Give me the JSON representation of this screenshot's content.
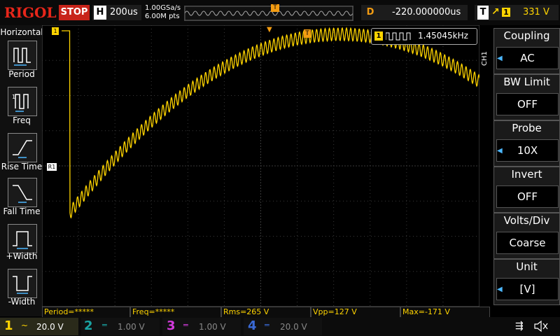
{
  "brand": "RIGOL",
  "run_state": "STOP",
  "horizontal": {
    "label": "H",
    "timebase": "200us",
    "sample_rate": "1.00GSa/s",
    "memory_depth": "6.00M pts"
  },
  "delay": {
    "label": "D",
    "value": "-220.000000us"
  },
  "trigger": {
    "label": "T",
    "edge_icon": "rising-edge-icon",
    "channel": "1",
    "level": "331 V"
  },
  "left_menu": {
    "title": "Horizontal",
    "items": [
      {
        "label": "Period",
        "icon": "period-icon"
      },
      {
        "label": "Freq",
        "icon": "frequency-icon"
      },
      {
        "label": "Rise Time",
        "icon": "rise-time-icon"
      },
      {
        "label": "Fall Time",
        "icon": "fall-time-icon"
      },
      {
        "label": "+Width",
        "icon": "positive-width-icon"
      },
      {
        "label": "-Width",
        "icon": "negative-width-icon"
      }
    ]
  },
  "frequency_counter": {
    "channel": "1",
    "value": "1.45045kHz"
  },
  "channel_tag": "CH1",
  "right_menu": [
    {
      "title": "Coupling",
      "value": "AC"
    },
    {
      "title": "BW Limit",
      "value": "OFF"
    },
    {
      "title": "Probe",
      "value": "10X"
    },
    {
      "title": "Invert",
      "value": "OFF"
    },
    {
      "title": "Volts/Div",
      "value": "Coarse"
    },
    {
      "title": "Unit",
      "value": "[V]"
    }
  ],
  "measurements": [
    "Period=*****",
    "Freq=*****",
    "Rms=265 V",
    "Vpp=127 V",
    "Max=-171 V"
  ],
  "channels": [
    {
      "number": "1",
      "coupling_icon": "ac-coupling-icon",
      "scale": "20.0 V",
      "color": "#ffd400",
      "active": true
    },
    {
      "number": "2",
      "coupling_icon": "dc-coupling-icon",
      "scale": "1.00 V",
      "color": "#1aa3a3",
      "active": false
    },
    {
      "number": "3",
      "coupling_icon": "dc-coupling-icon",
      "scale": "1.00 V",
      "color": "#d23adb",
      "active": false
    },
    {
      "number": "4",
      "coupling_icon": "dc-coupling-icon",
      "scale": "20.0 V",
      "color": "#3a6ad6",
      "active": false
    }
  ],
  "colors": {
    "ch1": "#ffd400",
    "stop": "#c8241a",
    "trigger_marker": "#f39c12",
    "grid": "#3a3a3a"
  },
  "status_icons": [
    "usb-icon",
    "speaker-muted-icon"
  ]
}
